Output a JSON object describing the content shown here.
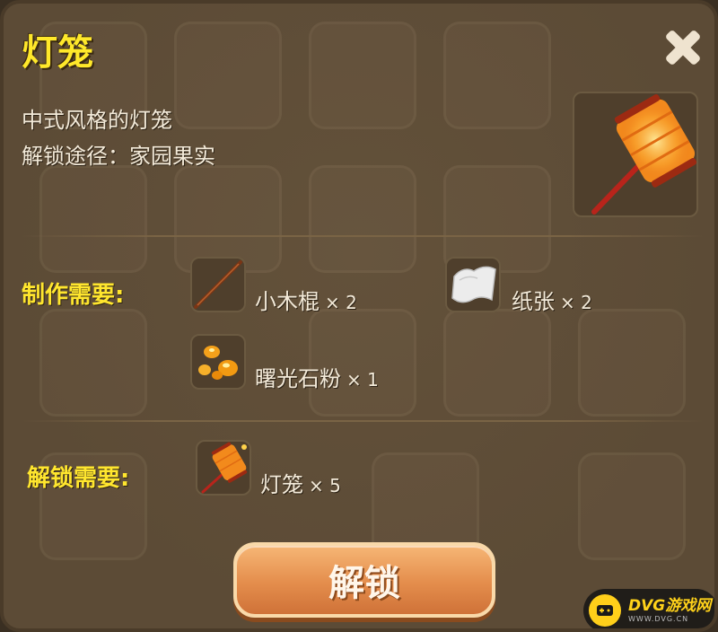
{
  "dialog": {
    "title": "灯笼",
    "description": "中式风格的灯笼",
    "unlock_path": "解锁途径：家园果实",
    "item_icon": "lantern-icon"
  },
  "crafting": {
    "label": "制作需要:",
    "materials": [
      {
        "name": "小木棍",
        "qty": "× 2",
        "icon": "stick-icon"
      },
      {
        "name": "纸张",
        "qty": "× 2",
        "icon": "paper-icon"
      },
      {
        "name": "曙光石粉",
        "qty": "× 1",
        "icon": "stone-powder-icon"
      }
    ]
  },
  "unlock_req": {
    "label": "解锁需要:",
    "items": [
      {
        "name": "灯笼",
        "qty": "× 5",
        "icon": "lantern-icon"
      }
    ]
  },
  "unlock_button": {
    "label": "解锁"
  },
  "watermark": {
    "main": "DVG游戏网",
    "sub": "WWW.DVG.CN"
  },
  "colors": {
    "title": "#ffe82a",
    "label": "#ffe62e",
    "button": "#e48d4c",
    "panel": "#5c4b36"
  }
}
